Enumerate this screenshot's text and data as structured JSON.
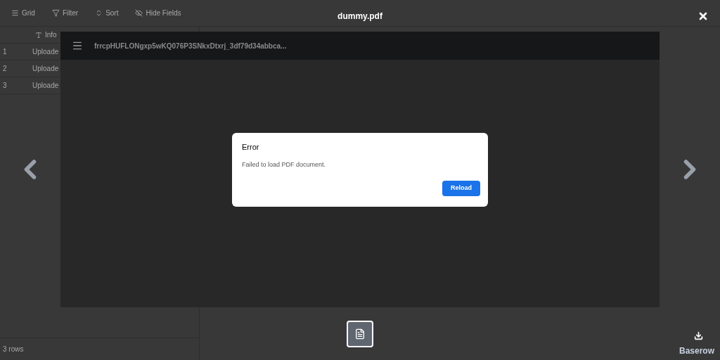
{
  "toolbar": [
    {
      "kind": "grid",
      "label": "Grid"
    },
    {
      "kind": "filter",
      "label": "Filter"
    },
    {
      "kind": "sort",
      "label": "Sort"
    },
    {
      "kind": "hide",
      "label": "Hide Fields"
    }
  ],
  "table": {
    "columns": [
      "Info"
    ],
    "rows": [
      {
        "number": "1",
        "cell": "Uploade"
      },
      {
        "number": "2",
        "cell": "Uploade"
      },
      {
        "number": "3",
        "cell": "Uploade"
      }
    ]
  },
  "status_bar": "3 rows",
  "brand": "Baserow",
  "viewer": {
    "title": "dummy.pdf",
    "document_name": "frrcpHUFLONgxp5wKQ076P3SNkxDtxrj_3df79d34abbca...",
    "dialog": {
      "title": "Error",
      "message": "Failed to load PDF document.",
      "button": "Reload"
    },
    "thumbnails": [
      {
        "kind": "pdf",
        "selected": true
      }
    ]
  }
}
